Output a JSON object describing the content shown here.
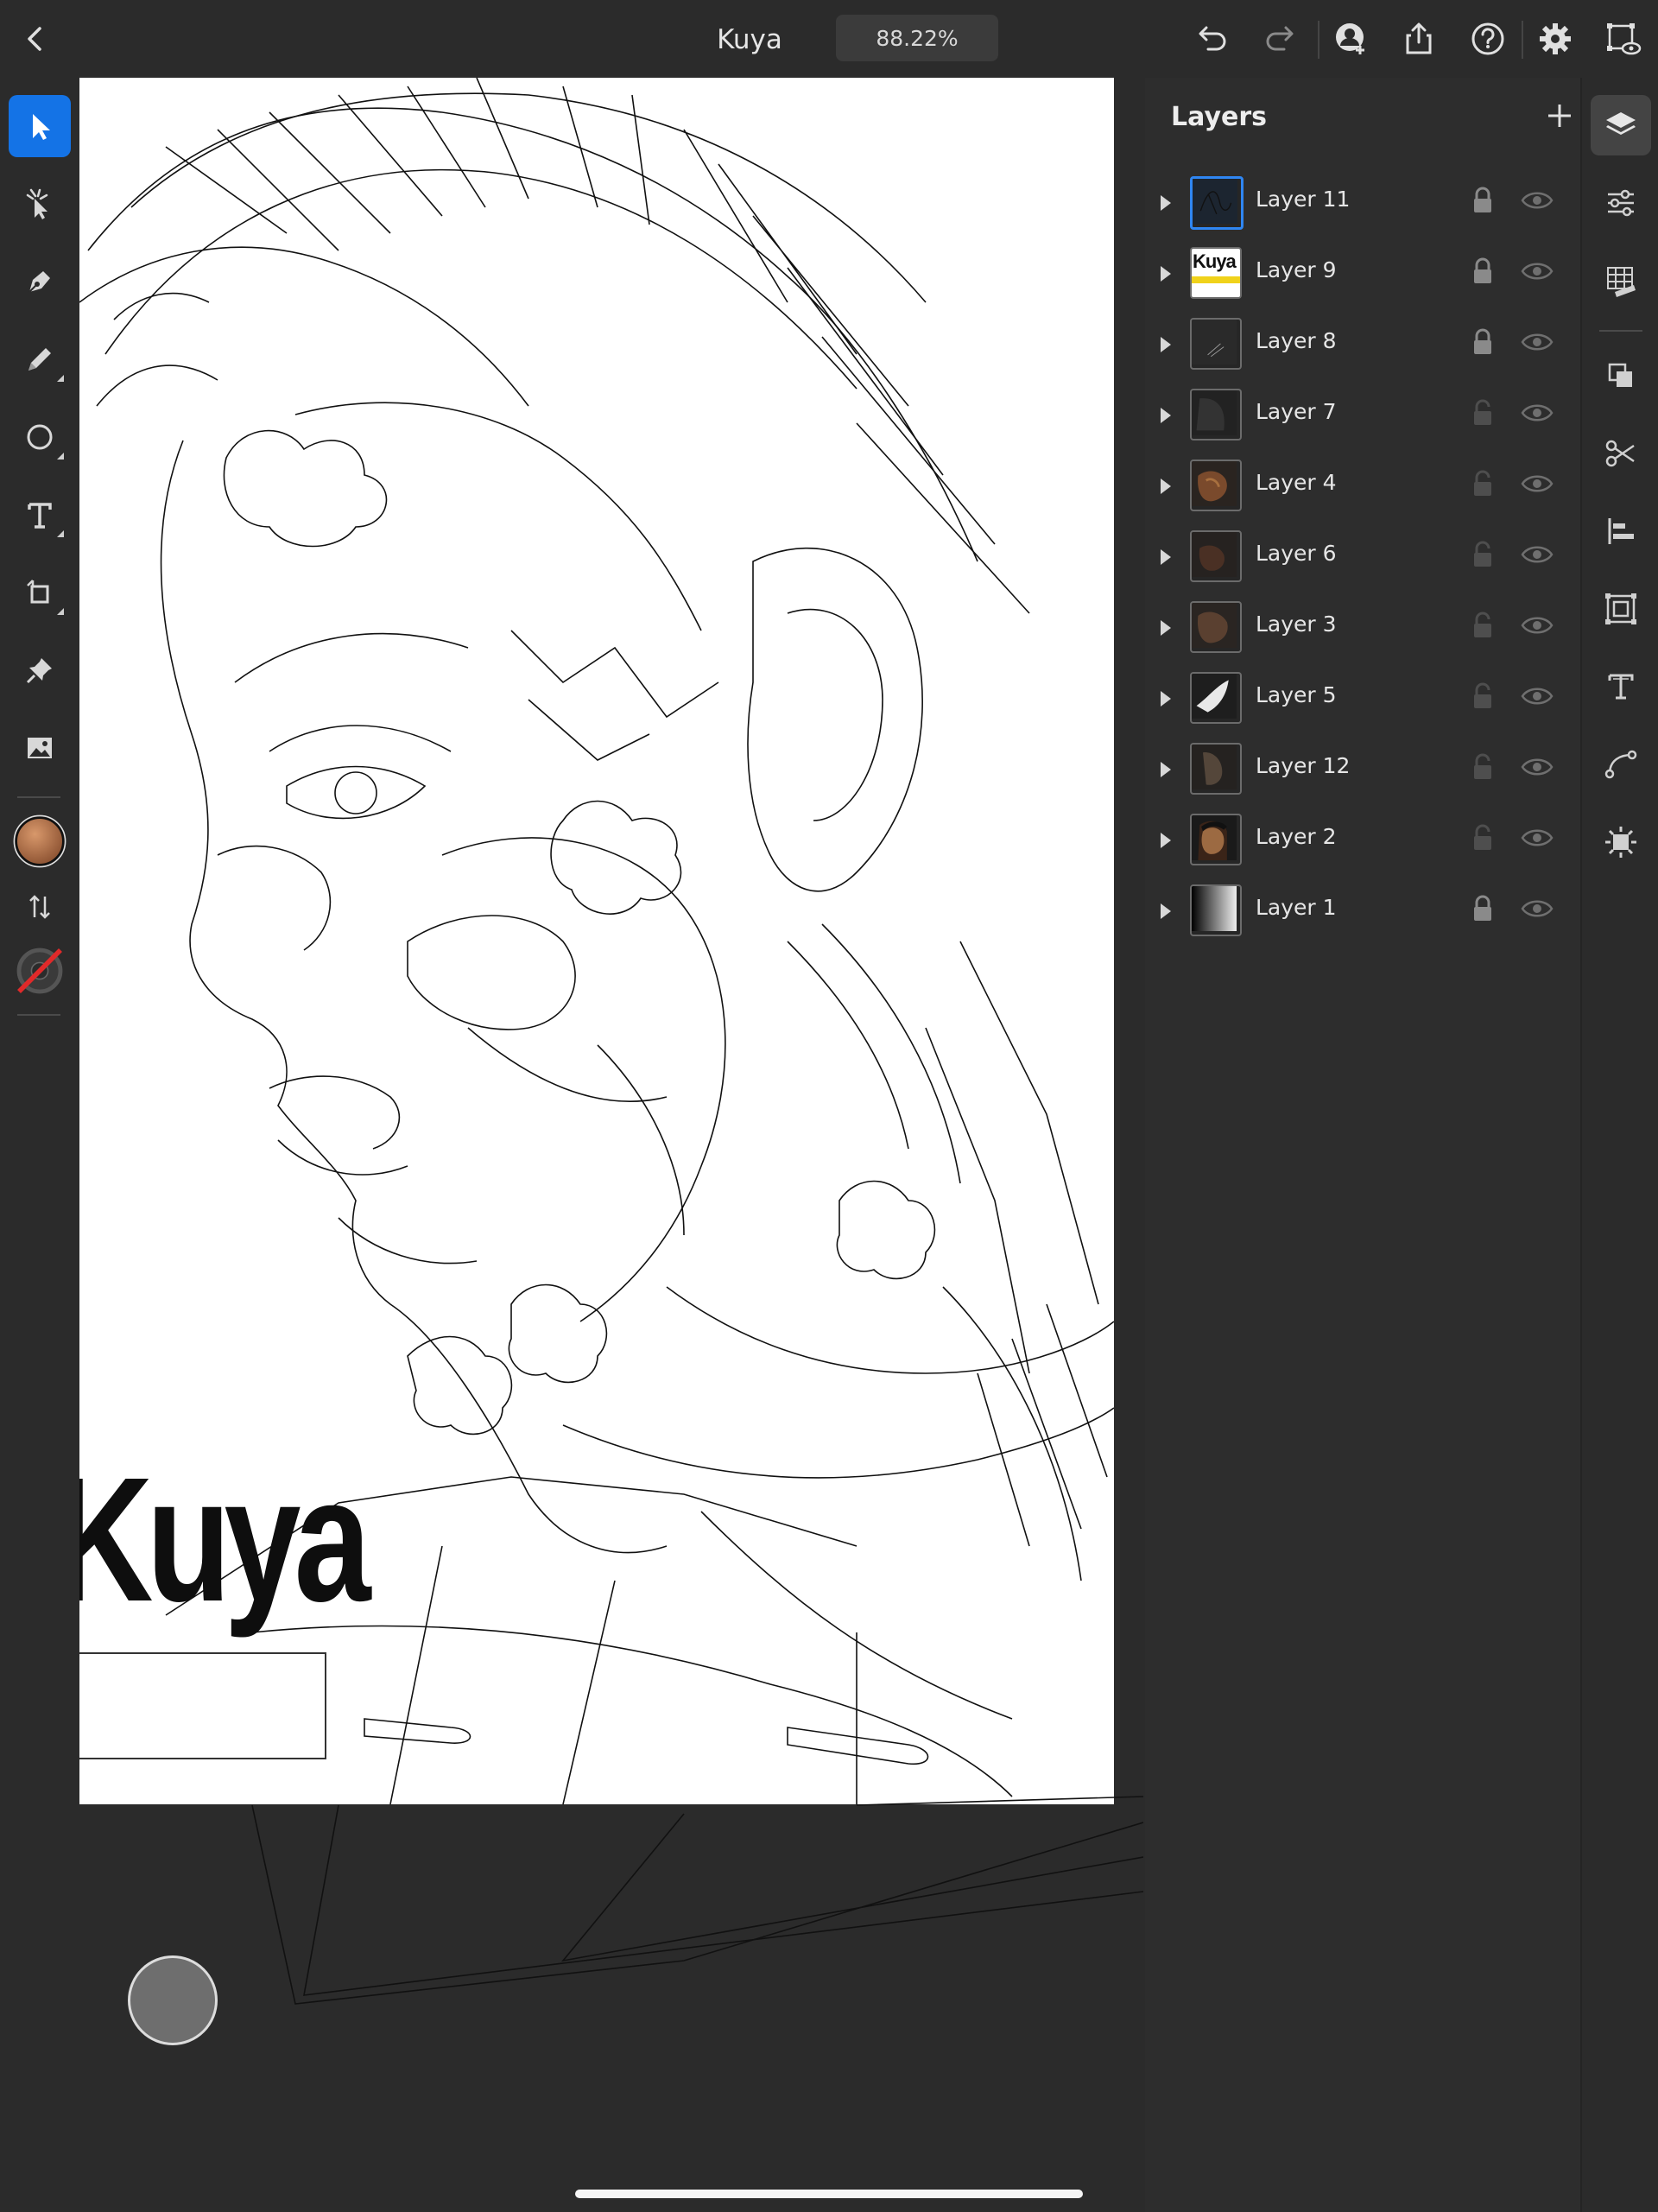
{
  "header": {
    "back_icon": "chevron-left-icon",
    "document_title": "Kuya",
    "zoom_level": "88.22%",
    "actions": [
      "undo-icon",
      "redo-icon",
      "invite-user-icon",
      "share-icon",
      "help-icon",
      "settings-icon",
      "preview-icon"
    ]
  },
  "tools": [
    {
      "name": "selection-tool",
      "icon": "arrow-pointer-icon",
      "active": true
    },
    {
      "name": "direct-selection-tool",
      "icon": "direct-select-icon"
    },
    {
      "name": "pen-tool",
      "icon": "pen-nib-icon"
    },
    {
      "name": "pencil-tool",
      "icon": "pencil-icon"
    },
    {
      "name": "shape-tool",
      "icon": "ellipse-icon"
    },
    {
      "name": "type-tool",
      "icon": "type-icon"
    },
    {
      "name": "transform-tool",
      "icon": "crop-rotate-icon"
    },
    {
      "name": "pin-tool",
      "icon": "pushpin-icon"
    },
    {
      "name": "place-image-tool",
      "icon": "image-icon"
    }
  ],
  "colors": {
    "fill": "#b8764a",
    "stroke": "none",
    "accent": "#1473e6"
  },
  "artboard": {
    "headline_text": "Kuya"
  },
  "layers_panel": {
    "title": "Layers",
    "add_icon": "plus-icon",
    "layers": [
      {
        "name": "Layer 11",
        "locked": true,
        "selected": true
      },
      {
        "name": "Layer 9",
        "locked": true,
        "thumb_text": "Kuya"
      },
      {
        "name": "Layer 8",
        "locked": true
      },
      {
        "name": "Layer 7",
        "locked": false
      },
      {
        "name": "Layer 4",
        "locked": false
      },
      {
        "name": "Layer 6",
        "locked": false
      },
      {
        "name": "Layer 3",
        "locked": false
      },
      {
        "name": "Layer 5",
        "locked": false
      },
      {
        "name": "Layer 12",
        "locked": false
      },
      {
        "name": "Layer 2",
        "locked": false
      },
      {
        "name": "Layer 1",
        "locked": true
      }
    ]
  },
  "right_rail": [
    "layers-icon",
    "properties-icon",
    "grid-icon",
    "arrange-icon",
    "scissors-icon",
    "align-icon",
    "repeat-icon",
    "text-style-icon",
    "path-icon",
    "effects-icon"
  ]
}
